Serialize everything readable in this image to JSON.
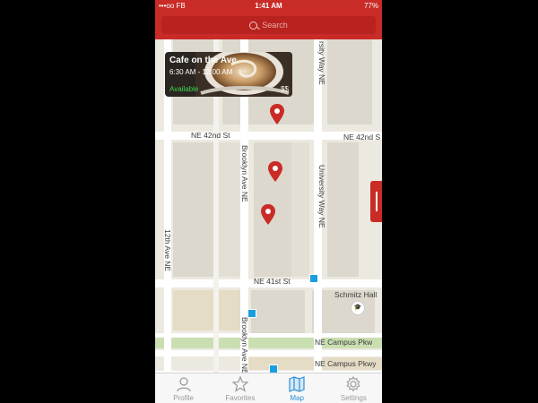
{
  "status_bar": {
    "carrier": "•••oo FB",
    "time": "1:41 AM",
    "battery": "77%"
  },
  "search": {
    "placeholder": "Search"
  },
  "card": {
    "title": "Cafe on the Ave",
    "hours": "6:30 AM - 12:00 AM",
    "availability": "Available",
    "price": "$$"
  },
  "map": {
    "streets": {
      "ne_42nd_left": "NE 42nd St",
      "ne_42nd_right": "NE 42nd S",
      "ne_41st": "NE 41st St",
      "campus_pkwy_1": "NE Campus Pkw",
      "campus_pkwy_2": "NE Campus Pkwy",
      "brooklyn_ave_1": "Brooklyn Ave NE",
      "brooklyn_ave_2": "Brooklyn Ave NE",
      "university_way_top": "rsity Way NE",
      "university_way": "University Way NE",
      "twelfth_ave": "12th Ave NE"
    },
    "places": {
      "schmitz_hall": "Schmitz Hall"
    }
  },
  "tabs": [
    {
      "label": "Profile",
      "icon": "person-icon",
      "active": false
    },
    {
      "label": "Favorites",
      "icon": "star-icon",
      "active": false
    },
    {
      "label": "Map",
      "icon": "map-icon",
      "active": true
    },
    {
      "label": "Settings",
      "icon": "gear-icon",
      "active": false
    }
  ],
  "colors": {
    "brand": "#c92b26",
    "active_tab": "#2e8fd6",
    "available": "#3ed54c"
  }
}
